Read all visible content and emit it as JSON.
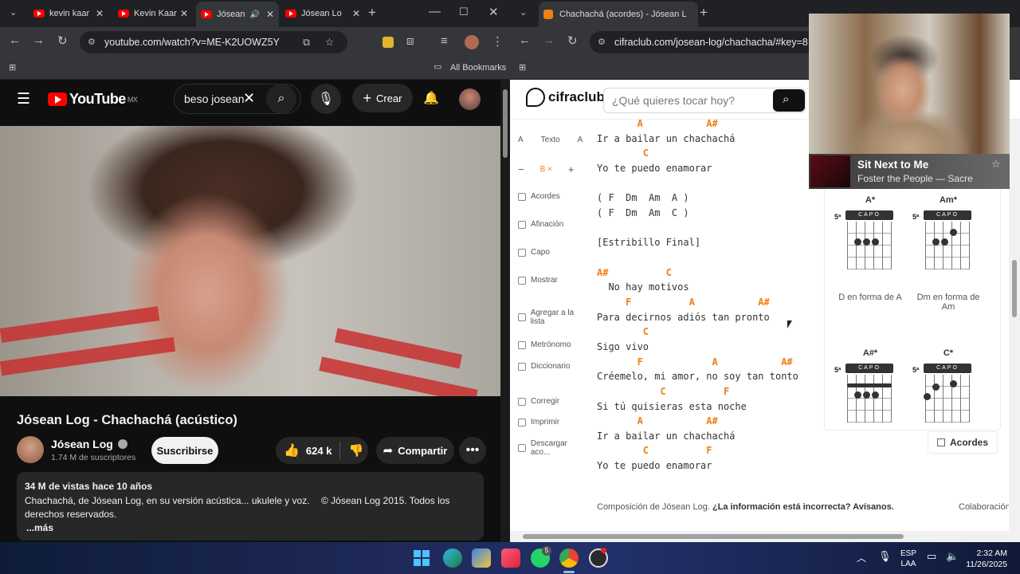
{
  "left_window": {
    "tabs": [
      "kevin kaar",
      "Kevin Kaar",
      "Jósean",
      "Jósean Lo"
    ],
    "new_tab": "+",
    "url": "youtube.com/watch?v=ME-K2UOWZ5Y",
    "bookmarks_label": "All Bookmarks",
    "youtube": {
      "logo": "YouTube",
      "region": "MX",
      "search_query": "beso josean",
      "create_label": "Crear",
      "video_title": "Jósean Log - Chachachá (acústico)",
      "channel_name": "Jósean Log",
      "subscribers": "1.74 M de suscriptores",
      "subscribe_label": "Suscribirse",
      "likes": "624 k",
      "share_label": "Compartir",
      "views_date": "34 M de vistas  hace 10 años",
      "description_line1": "Chachachá, de Jósean Log, en su versión acústica... ukulele y voz.",
      "copyright": "© Jósean Log 2015. Todos los",
      "description_line2": "derechos reservados.",
      "more_label": "...más"
    }
  },
  "right_window": {
    "tab_title": "Chachachá (acordes) - Jósean L",
    "new_tab": "+",
    "url": "cifraclub.com/josean-log/chachacha/#key=8",
    "site": {
      "logo": "cifraclub",
      "search_placeholder": "¿Qué quieres tocar hoy?",
      "sidebar": {
        "texto_a": "A",
        "texto": "Texto",
        "texto_a2": "A",
        "minus": "−",
        "b_label": "B ×",
        "plus": "+",
        "acordes": "Acordes",
        "afinacion": "Afinación",
        "capo": "Capo",
        "mostrar": "Mostrar",
        "agregar": "Agregar a la lista",
        "metronomo": "Metrónomo",
        "diccionario": "Diccionario",
        "corregir": "Corregir",
        "imprimir": "Imprimir",
        "descargar": "Descargar aco..."
      },
      "song_lines": [
        {
          "kind": "chord",
          "text": "       A           A#"
        },
        {
          "kind": "lyric",
          "text": "Ir a bailar un chachachá"
        },
        {
          "kind": "chord",
          "text": "        C"
        },
        {
          "kind": "lyric",
          "text": "Yo te puedo enamorar"
        },
        {
          "kind": "mixed",
          "text": "( F  Dm  Am  A )"
        },
        {
          "kind": "mixed",
          "text": "( F  Dm  Am  C )"
        },
        {
          "kind": "lyric",
          "text": "[Estribillo Final]"
        },
        {
          "kind": "chord",
          "text": "A#          C"
        },
        {
          "kind": "lyric",
          "text": "  No hay motivos"
        },
        {
          "kind": "chord",
          "text": "     F          A           A#"
        },
        {
          "kind": "lyric",
          "text": "Para decirnos adiós tan pronto"
        },
        {
          "kind": "chord",
          "text": "        C"
        },
        {
          "kind": "lyric",
          "text": "Sigo vivo"
        },
        {
          "kind": "chord",
          "text": "       F            A           A#"
        },
        {
          "kind": "lyric",
          "text": "Créemelo, mi amor, no soy tan tonto"
        },
        {
          "kind": "chord",
          "text": "           C          F"
        },
        {
          "kind": "lyric",
          "text": "Si tú quisieras esta noche"
        },
        {
          "kind": "chord",
          "text": "       A           A#"
        },
        {
          "kind": "lyric",
          "text": "Ir a bailar un chachachá"
        },
        {
          "kind": "chord",
          "text": "        C          F"
        },
        {
          "kind": "lyric",
          "text": "Yo te puedo enamorar"
        }
      ],
      "chords": [
        {
          "name": "A*",
          "fret": "5ª",
          "capo": "CAPO",
          "caption": "D en forma de A"
        },
        {
          "name": "Am*",
          "fret": "5ª",
          "capo": "CAPO",
          "caption": "Dm en forma de Am"
        },
        {
          "name": "A#*",
          "fret": "5ª",
          "capo": "CAPO",
          "caption": ""
        },
        {
          "name": "C*",
          "fret": "5ª",
          "capo": "CAPO",
          "caption": ""
        }
      ],
      "acordes_button": "Acordes",
      "footer_composition": "Composición de Jósean Log.",
      "footer_wrong": "¿La información está incorrecta? Avísanos.",
      "footer_collab": "Colaboración"
    }
  },
  "pip": {
    "song_title": "Sit Next to Me",
    "song_artist": "Foster the People — Sacre"
  },
  "taskbar": {
    "lang": "ESP",
    "layout": "LAA",
    "time": "2:32 AM",
    "date": "11/26/2025",
    "notif_count": "5"
  },
  "colors": {
    "chord": "#f07f14",
    "youtube_red": "#ff0000"
  }
}
